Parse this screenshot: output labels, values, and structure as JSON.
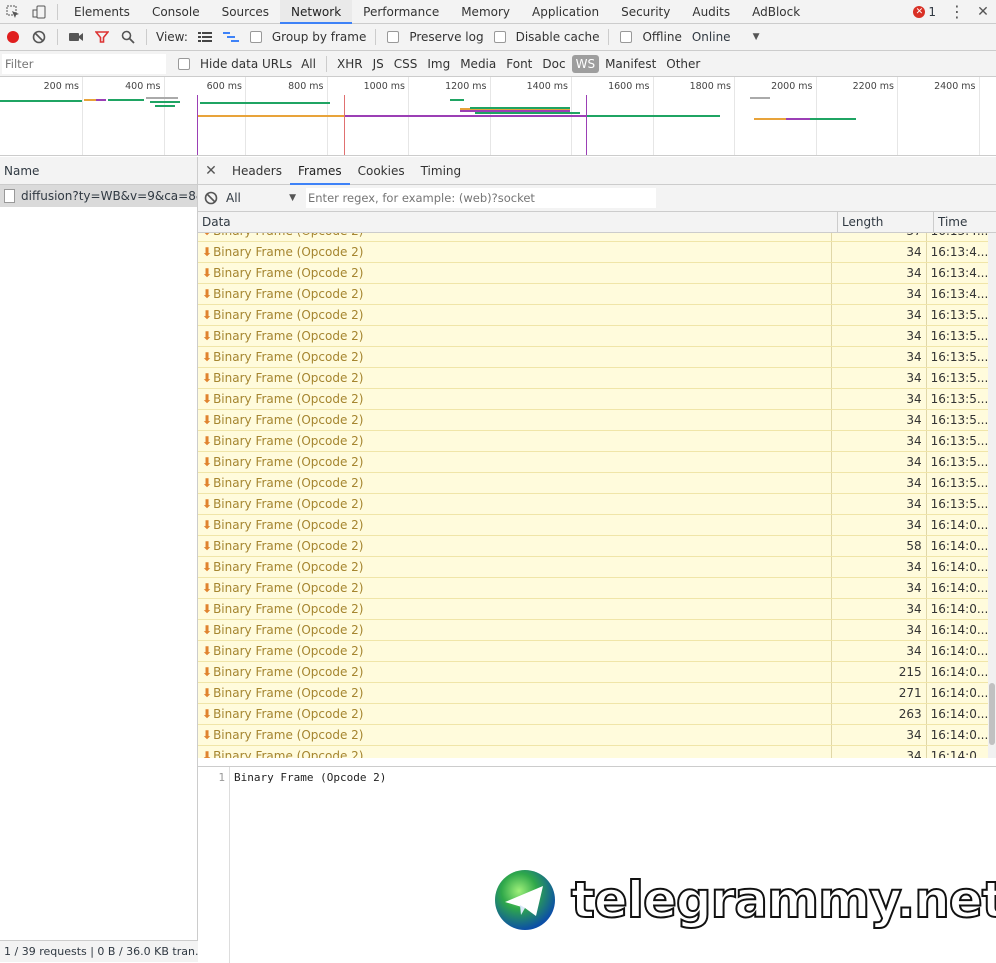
{
  "top_tabs": [
    "Elements",
    "Console",
    "Sources",
    "Network",
    "Performance",
    "Memory",
    "Application",
    "Security",
    "Audits",
    "AdBlock"
  ],
  "selected_tab": "Network",
  "error_count": "1",
  "toolbar": {
    "view_label": "View:",
    "group_by_frame": "Group by frame",
    "preserve_log": "Preserve log",
    "disable_cache": "Disable cache",
    "offline": "Offline",
    "throttle": "Online"
  },
  "filter": {
    "placeholder": "Filter",
    "hide_data_urls": "Hide data URLs",
    "types": [
      "All",
      "XHR",
      "JS",
      "CSS",
      "Img",
      "Media",
      "Font",
      "Doc",
      "WS",
      "Manifest",
      "Other"
    ],
    "selected_type": "WS"
  },
  "overview": {
    "ticks": [
      "200 ms",
      "400 ms",
      "600 ms",
      "800 ms",
      "1000 ms",
      "1200 ms",
      "1400 ms",
      "1600 ms",
      "1800 ms",
      "2000 ms",
      "2200 ms",
      "2400 ms"
    ]
  },
  "request_list": {
    "header": "Name",
    "items": [
      "diffusion?ty=WB&v=9&ca=8&..."
    ],
    "status": "1 / 39 requests  |  0 B / 36.0 KB tran..."
  },
  "detail_tabs": [
    "Headers",
    "Frames",
    "Cookies",
    "Timing"
  ],
  "selected_detail_tab": "Frames",
  "frames_filter": {
    "selected": "All",
    "regex_placeholder": "Enter regex, for example: (web)?socket"
  },
  "columns": [
    "Data",
    "Length",
    "Time"
  ],
  "frames": [
    {
      "data": "Binary Frame (Opcode 2)",
      "length": "34",
      "time": "16:13:4..."
    },
    {
      "data": "Binary Frame (Opcode 2)",
      "length": "34",
      "time": "16:13:4..."
    },
    {
      "data": "Binary Frame (Opcode 2)",
      "length": "34",
      "time": "16:13:4..."
    },
    {
      "data": "Binary Frame (Opcode 2)",
      "length": "34",
      "time": "16:13:5..."
    },
    {
      "data": "Binary Frame (Opcode 2)",
      "length": "34",
      "time": "16:13:5..."
    },
    {
      "data": "Binary Frame (Opcode 2)",
      "length": "34",
      "time": "16:13:5..."
    },
    {
      "data": "Binary Frame (Opcode 2)",
      "length": "34",
      "time": "16:13:5..."
    },
    {
      "data": "Binary Frame (Opcode 2)",
      "length": "34",
      "time": "16:13:5..."
    },
    {
      "data": "Binary Frame (Opcode 2)",
      "length": "34",
      "time": "16:13:5..."
    },
    {
      "data": "Binary Frame (Opcode 2)",
      "length": "34",
      "time": "16:13:5..."
    },
    {
      "data": "Binary Frame (Opcode 2)",
      "length": "34",
      "time": "16:13:5..."
    },
    {
      "data": "Binary Frame (Opcode 2)",
      "length": "34",
      "time": "16:13:5..."
    },
    {
      "data": "Binary Frame (Opcode 2)",
      "length": "34",
      "time": "16:13:5..."
    },
    {
      "data": "Binary Frame (Opcode 2)",
      "length": "34",
      "time": "16:14:0..."
    },
    {
      "data": "Binary Frame (Opcode 2)",
      "length": "58",
      "time": "16:14:0..."
    },
    {
      "data": "Binary Frame (Opcode 2)",
      "length": "34",
      "time": "16:14:0..."
    },
    {
      "data": "Binary Frame (Opcode 2)",
      "length": "34",
      "time": "16:14:0..."
    },
    {
      "data": "Binary Frame (Opcode 2)",
      "length": "34",
      "time": "16:14:0..."
    },
    {
      "data": "Binary Frame (Opcode 2)",
      "length": "34",
      "time": "16:14:0..."
    },
    {
      "data": "Binary Frame (Opcode 2)",
      "length": "34",
      "time": "16:14:0..."
    },
    {
      "data": "Binary Frame (Opcode 2)",
      "length": "215",
      "time": "16:14:0..."
    },
    {
      "data": "Binary Frame (Opcode 2)",
      "length": "271",
      "time": "16:14:0..."
    },
    {
      "data": "Binary Frame (Opcode 2)",
      "length": "263",
      "time": "16:14:0..."
    },
    {
      "data": "Binary Frame (Opcode 2)",
      "length": "34",
      "time": "16:14:0..."
    },
    {
      "data": "Binary Frame (Opcode 2)",
      "length": "34",
      "time": "16:14:0..."
    }
  ],
  "preview": {
    "line_number": "1",
    "content": "Binary Frame (Opcode 2)"
  },
  "watermark": "telegrammy.net"
}
